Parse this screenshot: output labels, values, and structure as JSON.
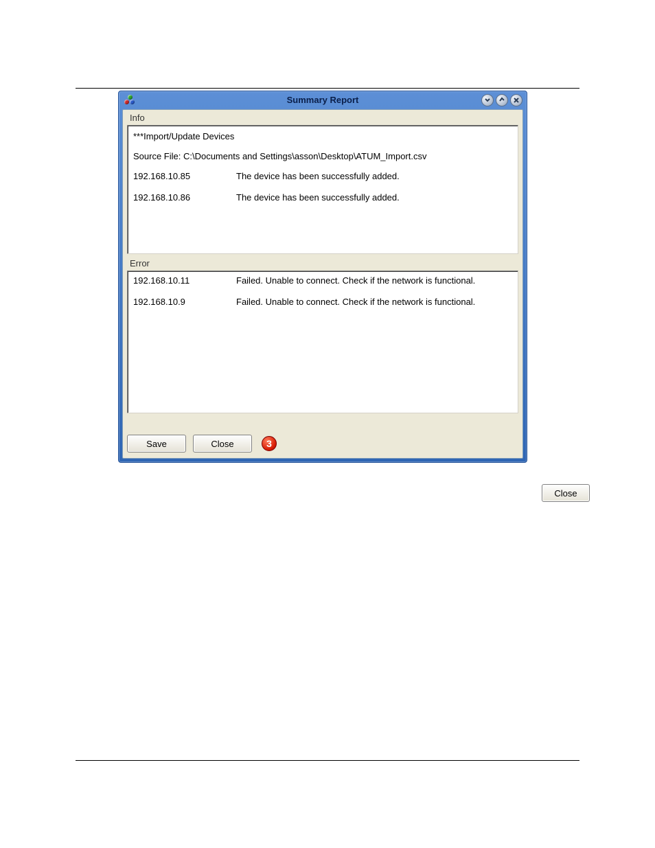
{
  "dialog": {
    "title": "Summary Report",
    "info_label": "Info",
    "error_label": "Error",
    "info_header": "***Import/Update Devices",
    "info_source": "Source File: C:\\Documents and Settings\\asson\\Desktop\\ATUM_Import.csv",
    "info_rows": [
      {
        "ip": "192.168.10.85",
        "msg": "The device has been successfully added."
      },
      {
        "ip": "192.168.10.86",
        "msg": "The device has been successfully added."
      }
    ],
    "error_rows": [
      {
        "ip": "192.168.10.11",
        "msg": "Failed. Unable to connect. Check if the network is functional."
      },
      {
        "ip": "192.168.10.9",
        "msg": "Failed. Unable to connect. Check if the network is functional."
      }
    ],
    "buttons": {
      "save": "Save",
      "close": "Close"
    },
    "callout": "3"
  },
  "floating": {
    "close": "Close"
  }
}
